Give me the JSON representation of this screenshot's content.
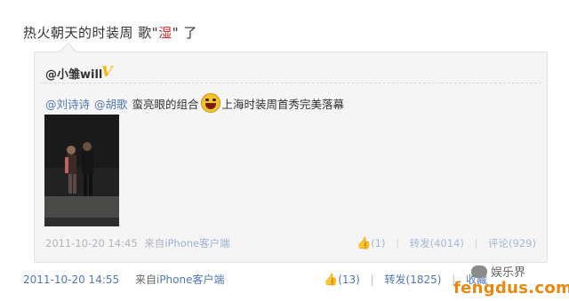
{
  "post": {
    "text_prefix": "热火朝天的时装周 歌",
    "quote_open": "\"",
    "highlight": "湿",
    "quote_close": "\"",
    "text_suffix": "了"
  },
  "repost": {
    "author": "@小雏will",
    "badge": "V",
    "mention1": "@刘诗诗",
    "mention2": "@胡歌",
    "text_middle": "蛮亮眼的组合",
    "text_end": "上海时装周首秀完美落幕",
    "time": "2011-10-20 14:45",
    "source_prefix": "来自",
    "source": "iPhone客户端",
    "like_icon": "thumbs-up-icon",
    "like_count": "(1)",
    "forward": "转发(4014)",
    "comment": "评论(929)"
  },
  "footer": {
    "time": "2011-10-20 14:55",
    "source_prefix": "来自",
    "source": "iPhone客户端",
    "like_count": "(13)",
    "forward": "转发(1825)",
    "favorite": "收藏"
  },
  "watermark": {
    "top": "娱乐界",
    "bottom": "fengdus.com"
  },
  "colors": {
    "link": "#5177b8",
    "highlight": "#d2232a",
    "badge": "#f2b700",
    "watermark": "#e8880d"
  }
}
